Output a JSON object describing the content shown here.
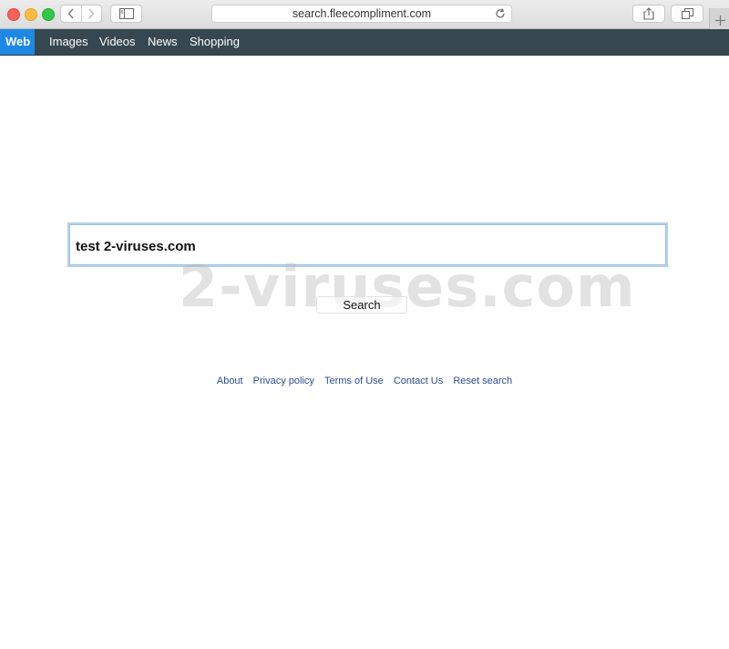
{
  "browser": {
    "url": "search.fleecompliment.com"
  },
  "nav": {
    "items": [
      {
        "label": "Web",
        "active": true
      },
      {
        "label": "Images"
      },
      {
        "label": "Videos"
      },
      {
        "label": "News"
      },
      {
        "label": "Shopping"
      }
    ]
  },
  "search": {
    "value": "test 2-viruses.com",
    "button_label": "Search"
  },
  "watermark": "2-viruses.com",
  "footer": {
    "links": [
      "About",
      "Privacy policy",
      "Terms of Use",
      "Contact Us",
      "Reset search"
    ]
  },
  "colors": {
    "navbar": "#37474f",
    "active_tab": "#1e88e5",
    "link": "#2a4d8f"
  }
}
